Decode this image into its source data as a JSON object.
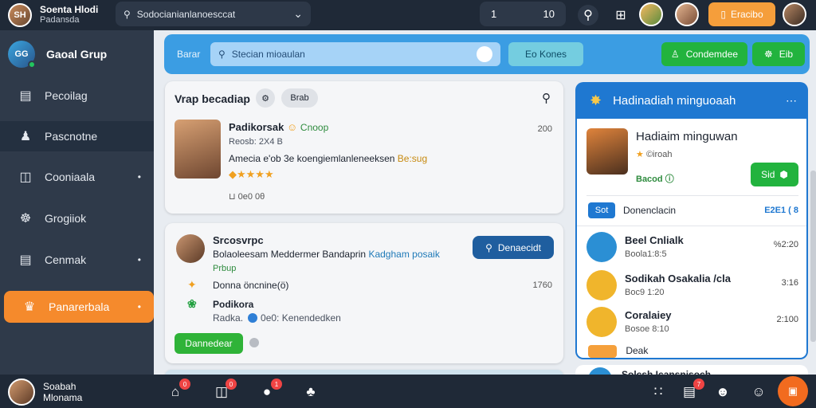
{
  "topbar": {
    "user_name": "Soenta Hlodi",
    "user_sub": "Padansda",
    "search_text": "Sodocianianlanoesccat",
    "counter_label": "1",
    "counter_value": "10",
    "cta_label": "Eracibo"
  },
  "sidebar": {
    "group_name": "Gaoal Grup",
    "items": [
      {
        "label": "Pecoilag"
      },
      {
        "label": "Pascnotne"
      },
      {
        "label": "Cooniaala"
      },
      {
        "label": "Grogiiok"
      },
      {
        "label": "Cenmak"
      },
      {
        "label": "Panarerbala"
      }
    ]
  },
  "toolbar": {
    "label": "Barar",
    "search_placeholder": "Stecian mioaulan",
    "btn1": "Eo  Kones",
    "btn2": "Condemdee",
    "btn3": "Eib"
  },
  "card1": {
    "title": "Vrap becadiap",
    "chip": "Brab",
    "author": "Padikorsak",
    "author_tag": "Cnoop",
    "time": "200",
    "sub": "Reosb: 2X4 B",
    "line_text": "Amecia e'ob 3e koengiemlanleneeksen",
    "line_highlight": "Be:sug",
    "meta": "⊔ 0e0 0θ"
  },
  "card2": {
    "author": "Srcosvrpc",
    "desc": "Bolaoleesam Meddermer Bandaprin",
    "desc_link": "Kadgham posaik",
    "tag": "Prbup",
    "action": "Denaecidt",
    "row1_text": "Donna öncnine(ö)",
    "row1_value": "1760",
    "row2_text": "Podikora",
    "row3_pre": "Radka.",
    "row3_post": "0e0: Kenendedken",
    "green_btn": "Dannedear"
  },
  "right_panel": {
    "title": "Hadinadiah minguoaah",
    "featured": {
      "name": "Hadiaim minguwan",
      "sub": "©iroah",
      "tag": "Bacod",
      "btn": "Sid"
    },
    "filter_pill": "Sot",
    "filter_text": "Donenclacin",
    "filter_count": "E2E1 ( 8",
    "rows": [
      {
        "name": "Beel Cnlialk",
        "sub": "Boola1:8:5",
        "value": "%2:20"
      },
      {
        "name": "Sodikah Osakalia /cla",
        "sub": "Boc9 1:20",
        "value": "3:16"
      },
      {
        "name": "Coralaiey",
        "sub": "Bosoe 8:10",
        "value": "2:100"
      }
    ],
    "cut_text": "Deak",
    "tail_text": "Solcsh Icansnisoch"
  },
  "bottombar": {
    "user_name": "Soabah",
    "user_sub": "Mlonama",
    "badges": [
      "0",
      "0",
      "1",
      "",
      "7"
    ]
  }
}
